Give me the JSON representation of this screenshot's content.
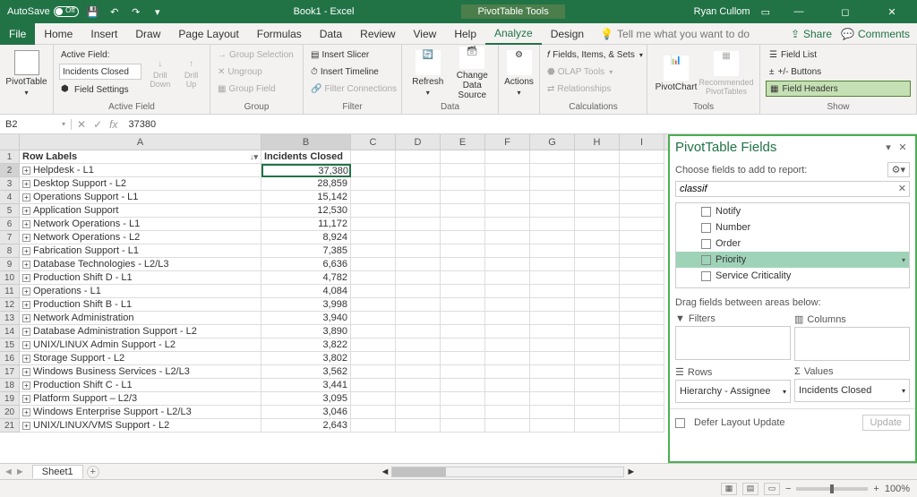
{
  "titlebar": {
    "autosave": "AutoSave",
    "autosave_state": "Off",
    "doc_title": "Book1 - Excel",
    "contextual": "PivotTable Tools",
    "user": "Ryan Cullom"
  },
  "menu": {
    "items": [
      "File",
      "Home",
      "Insert",
      "Draw",
      "Page Layout",
      "Formulas",
      "Data",
      "Review",
      "View",
      "Help",
      "Analyze",
      "Design"
    ],
    "active": "Analyze",
    "tell_me": "Tell me what you want to do",
    "share": "Share",
    "comments": "Comments"
  },
  "ribbon": {
    "pivot_table": "PivotTable",
    "active_field_label": "Active Field:",
    "active_field_value": "Incidents Closed",
    "field_settings": "Field Settings",
    "drill_down": "Drill Down",
    "drill_up": "Drill Up",
    "group_selection": "Group Selection",
    "ungroup": "Ungroup",
    "group_field": "Group Field",
    "insert_slicer": "Insert Slicer",
    "insert_timeline": "Insert Timeline",
    "filter_connections": "Filter Connections",
    "refresh": "Refresh",
    "change_data_source": "Change Data Source",
    "actions": "Actions",
    "fields_items_sets": "Fields, Items, & Sets",
    "olap_tools": "OLAP Tools",
    "relationships": "Relationships",
    "pivotchart": "PivotChart",
    "recommended": "Recommended PivotTables",
    "field_list": "Field List",
    "pm_buttons": "+/- Buttons",
    "field_headers": "Field Headers",
    "groups": {
      "active_field": "Active Field",
      "group": "Group",
      "filter": "Filter",
      "data": "Data",
      "calculations": "Calculations",
      "tools": "Tools",
      "show": "Show"
    }
  },
  "formula": {
    "name_box": "B2",
    "value": "37380"
  },
  "grid": {
    "columns": [
      "A",
      "B",
      "C",
      "D",
      "E",
      "F",
      "G",
      "H",
      "I"
    ],
    "header_row": {
      "a": "Row Labels",
      "b": "Incidents Closed"
    },
    "selected_cell": "B2",
    "rows": [
      {
        "n": 2,
        "a": "Helpdesk - L1",
        "b": "37,380"
      },
      {
        "n": 3,
        "a": "Desktop Support - L2",
        "b": "28,859"
      },
      {
        "n": 4,
        "a": "Operations Support - L1",
        "b": "15,142"
      },
      {
        "n": 5,
        "a": "Application Support",
        "b": "12,530"
      },
      {
        "n": 6,
        "a": "Network Operations - L1",
        "b": "11,172"
      },
      {
        "n": 7,
        "a": "Network Operations - L2",
        "b": "8,924"
      },
      {
        "n": 8,
        "a": "Fabrication Support - L1",
        "b": "7,385"
      },
      {
        "n": 9,
        "a": "Database Technologies - L2/L3",
        "b": "6,636"
      },
      {
        "n": 10,
        "a": "Production Shift D - L1",
        "b": "4,782"
      },
      {
        "n": 11,
        "a": "Operations - L1",
        "b": "4,084"
      },
      {
        "n": 12,
        "a": "Production Shift B - L1",
        "b": "3,998"
      },
      {
        "n": 13,
        "a": "Network Administration",
        "b": "3,940"
      },
      {
        "n": 14,
        "a": "Database Administration Support - L2",
        "b": "3,890"
      },
      {
        "n": 15,
        "a": "UNIX/LINUX Admin Support - L2",
        "b": "3,822"
      },
      {
        "n": 16,
        "a": "Storage Support - L2",
        "b": "3,802"
      },
      {
        "n": 17,
        "a": "Windows Business Services - L2/L3",
        "b": "3,562"
      },
      {
        "n": 18,
        "a": "Production Shift C - L1",
        "b": "3,441"
      },
      {
        "n": 19,
        "a": "Platform Support – L2/3",
        "b": "3,095"
      },
      {
        "n": 20,
        "a": "Windows Enterprise Support - L2/L3",
        "b": "3,046"
      },
      {
        "n": 21,
        "a": "UNIX/LINUX/VMS Support - L2",
        "b": "2,643"
      }
    ]
  },
  "pane": {
    "title": "PivotTable Fields",
    "choose": "Choose fields to add to report:",
    "search": "classif",
    "fields": [
      "Notify",
      "Number",
      "Order",
      "Priority",
      "Service Criticality"
    ],
    "hover_field": "Priority",
    "drag_label": "Drag fields between areas below:",
    "filters": "Filters",
    "columns": "Columns",
    "rows": "Rows",
    "values": "Values",
    "rows_value": "Hierarchy - Assignee",
    "values_value": "Incidents Closed",
    "defer": "Defer Layout Update",
    "update": "Update"
  },
  "sheet": {
    "name": "Sheet1"
  },
  "status": {
    "zoom": "100%"
  }
}
